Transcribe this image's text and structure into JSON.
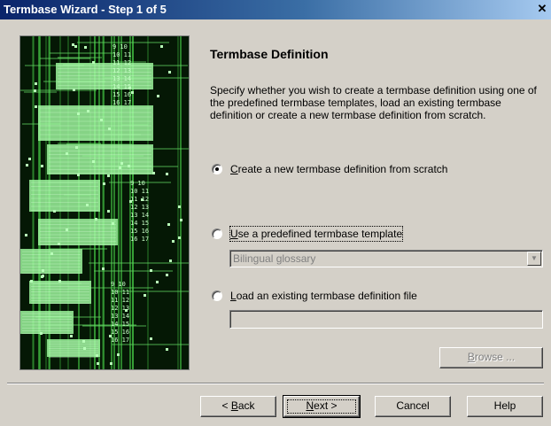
{
  "window": {
    "title": "Termbase Wizard - Step 1 of 5",
    "close_glyph": "✕"
  },
  "side_image": {
    "icon": "circuit-board-illustration"
  },
  "content": {
    "heading": "Termbase Definition",
    "description": "Specify whether you wish to create a termbase definition using one of the predefined termbase templates, load an existing termbase definition or create a new termbase definition from scratch."
  },
  "options": {
    "selected": "create_new",
    "create_new": {
      "access_key": "C",
      "label_rest": "reate a new termbase definition from scratch"
    },
    "use_template": {
      "access_key": "U",
      "label_rest": "se a predefined termbase template"
    },
    "load_existing": {
      "access_key": "L",
      "label_rest": "oad an existing termbase definition file"
    }
  },
  "template_combo": {
    "value": "Bilingual glossary",
    "enabled": false
  },
  "file_path": {
    "value": "",
    "enabled": false
  },
  "browse_button": {
    "label": "Browse ...",
    "access_key": "B",
    "label_rest": "rowse ...",
    "enabled": false
  },
  "nav": {
    "back": {
      "prefix": "< ",
      "access_key": "B",
      "label_rest": "ack"
    },
    "next": {
      "access_key": "N",
      "label_rest": "ext >"
    },
    "cancel": "Cancel",
    "help": "Help"
  }
}
